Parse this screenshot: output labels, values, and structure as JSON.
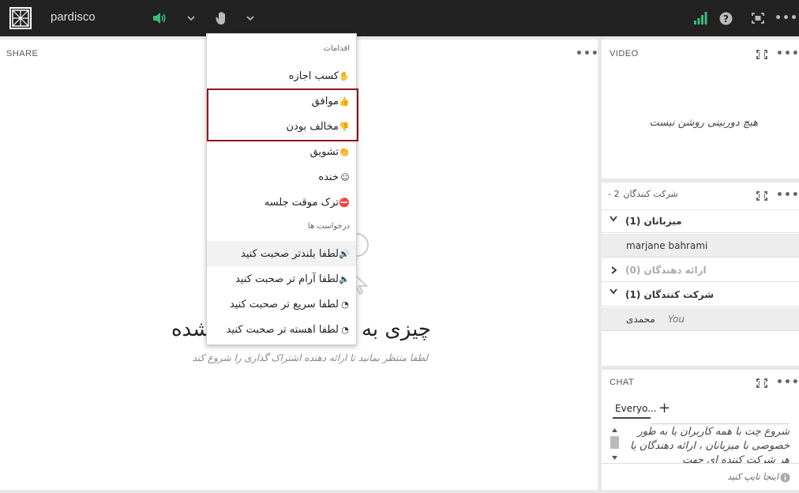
{
  "topbar": {
    "brand": "pardisco"
  },
  "colors": {
    "topbar_bg": "#222222",
    "accent_green": "#3cba7a",
    "highlight_box": "#8b1a1a"
  },
  "icons": {
    "logo": "app-logo-icon",
    "audio": "speaker-icon",
    "hand": "raise-hand-icon",
    "chevron": "chevron-down-icon",
    "signal": "signal-bars-icon",
    "help": "help-icon",
    "fullscreen": "fullscreen-icon",
    "more": "more-icon"
  },
  "share": {
    "title": "SHARE",
    "empty_title": "چیزی به اشتراک گذاشته نشده",
    "empty_sub": "لطفا منتظر بمانید تا ارائه دهنده اشتراک گذاری را شروع کند"
  },
  "menu": {
    "actions_header": "اقدامات",
    "requests_header": "درخواست ها",
    "items": [
      {
        "label": "کسب اجازه",
        "icon": "✋"
      },
      {
        "label": "موافق",
        "icon": "👍"
      },
      {
        "label": "مخالف بودن",
        "icon": "👎"
      },
      {
        "label": "تشویق",
        "icon": "👏"
      },
      {
        "label": "خنده",
        "icon": "☺"
      },
      {
        "label": "ترک موقت جلسه",
        "icon": "⛔"
      }
    ],
    "requests": [
      {
        "label": "لطفا بلندتر صحبت کنید",
        "icon": "🔊"
      },
      {
        "label": "لطفا آرام تر صحبت کنید",
        "icon": "🔈"
      },
      {
        "label": "لطفا سریع تر صحبت کنید",
        "icon": "◔"
      },
      {
        "label": "لطفا اهسته تر صحبت کنید",
        "icon": "◔"
      }
    ]
  },
  "video": {
    "title": "VIDEO",
    "empty": "هیچ دوربینی روشن نیست"
  },
  "participants": {
    "title": "شرکت کنندگان",
    "count": "2 -",
    "groups": [
      {
        "name": "میزبانان (1)",
        "chevron": "⌄"
      },
      {
        "name": "ارائه دهندگان (0)",
        "chevron": "›"
      },
      {
        "name": "شرکت کنندگان (1)",
        "chevron": "⌄"
      }
    ],
    "host_member": "marjane bahrami",
    "attendee_member": "محمدی",
    "you_label": "You"
  },
  "chat": {
    "title": "CHAT",
    "tab": "Everyo...",
    "plus": "+",
    "message": "شروع چت با همه کاربران یا به طور خصوصی با میزبانان ، ارائه دهندگان یا هر شرکت کننده ای جهت",
    "placeholder": "اینجا تایپ کنید"
  }
}
